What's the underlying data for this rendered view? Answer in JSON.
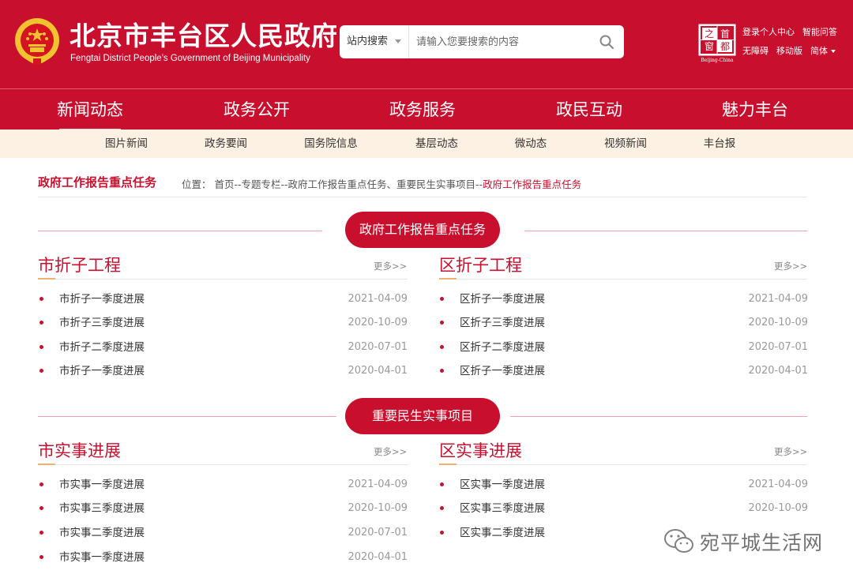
{
  "header": {
    "title": "北京市丰台区人民政府",
    "subtitle": "Fengtai District People's Government of Beijing Municipality",
    "search": {
      "scope": "站内搜索",
      "placeholder": "请输入您要搜索的内容"
    },
    "top_links": {
      "login": "登录个人中心",
      "smart_qa": "智能问答",
      "accessible": "无障碍",
      "mobile": "移动版",
      "language": "简体"
    },
    "capital_logo": {
      "chars": [
        "首",
        "都",
        "之",
        "窗"
      ],
      "caption": "Beijing-China"
    }
  },
  "main_nav": [
    {
      "label": "新闻动态"
    },
    {
      "label": "政务公开"
    },
    {
      "label": "政务服务"
    },
    {
      "label": "政民互动"
    },
    {
      "label": "魅力丰台"
    }
  ],
  "sub_nav": [
    {
      "label": "图片新闻"
    },
    {
      "label": "政务要闻"
    },
    {
      "label": "国务院信息"
    },
    {
      "label": "基层动态"
    },
    {
      "label": "微动态"
    },
    {
      "label": "视频新闻"
    },
    {
      "label": "丰台报"
    }
  ],
  "page": {
    "heading": "政府工作报告重点任务",
    "location_label": "位置：",
    "crumbs": "首页--专题专栏--政府工作报告重点任务、重要民生实事项目--",
    "crumb_current": "政府工作报告重点任务"
  },
  "sections": [
    {
      "title": "政府工作报告重点任务",
      "columns": [
        {
          "title": "市折子工程",
          "more": "更多>>",
          "items": [
            {
              "text": "市折子一季度进展",
              "date": "2021-04-09"
            },
            {
              "text": "市折子三季度进展",
              "date": "2020-10-09"
            },
            {
              "text": "市折子二季度进展",
              "date": "2020-07-01"
            },
            {
              "text": "市折子一季度进展",
              "date": "2020-04-01"
            }
          ]
        },
        {
          "title": "区折子工程",
          "more": "更多>>",
          "items": [
            {
              "text": "区折子一季度进展",
              "date": "2021-04-09"
            },
            {
              "text": "区折子三季度进展",
              "date": "2020-10-09"
            },
            {
              "text": "区折子二季度进展",
              "date": "2020-07-01"
            },
            {
              "text": "区折子一季度进展",
              "date": "2020-04-01"
            }
          ]
        }
      ]
    },
    {
      "title": "重要民生实事项目",
      "columns": [
        {
          "title": "市实事进展",
          "more": "更多>>",
          "items": [
            {
              "text": "市实事一季度进展",
              "date": "2021-04-09"
            },
            {
              "text": "市实事三季度进展",
              "date": "2020-10-09"
            },
            {
              "text": "市实事二季度进展",
              "date": "2020-07-01"
            },
            {
              "text": "市实事一季度进展",
              "date": "2020-04-01"
            }
          ]
        },
        {
          "title": "区实事进展",
          "more": "更多>>",
          "items": [
            {
              "text": "区实事一季度进展",
              "date": "2021-04-09"
            },
            {
              "text": "区实事三季度进展",
              "date": "2020-10-09"
            },
            {
              "text": "区实事二季度进展",
              "date": ""
            }
          ]
        }
      ]
    }
  ],
  "watermark": {
    "text": "宛平城生活网"
  },
  "colors": {
    "brand_red": "#c8102e",
    "subnav_bg": "#fdf1e3",
    "accent_gold": "#f0b070",
    "emblem_gold": "#f2c230"
  }
}
